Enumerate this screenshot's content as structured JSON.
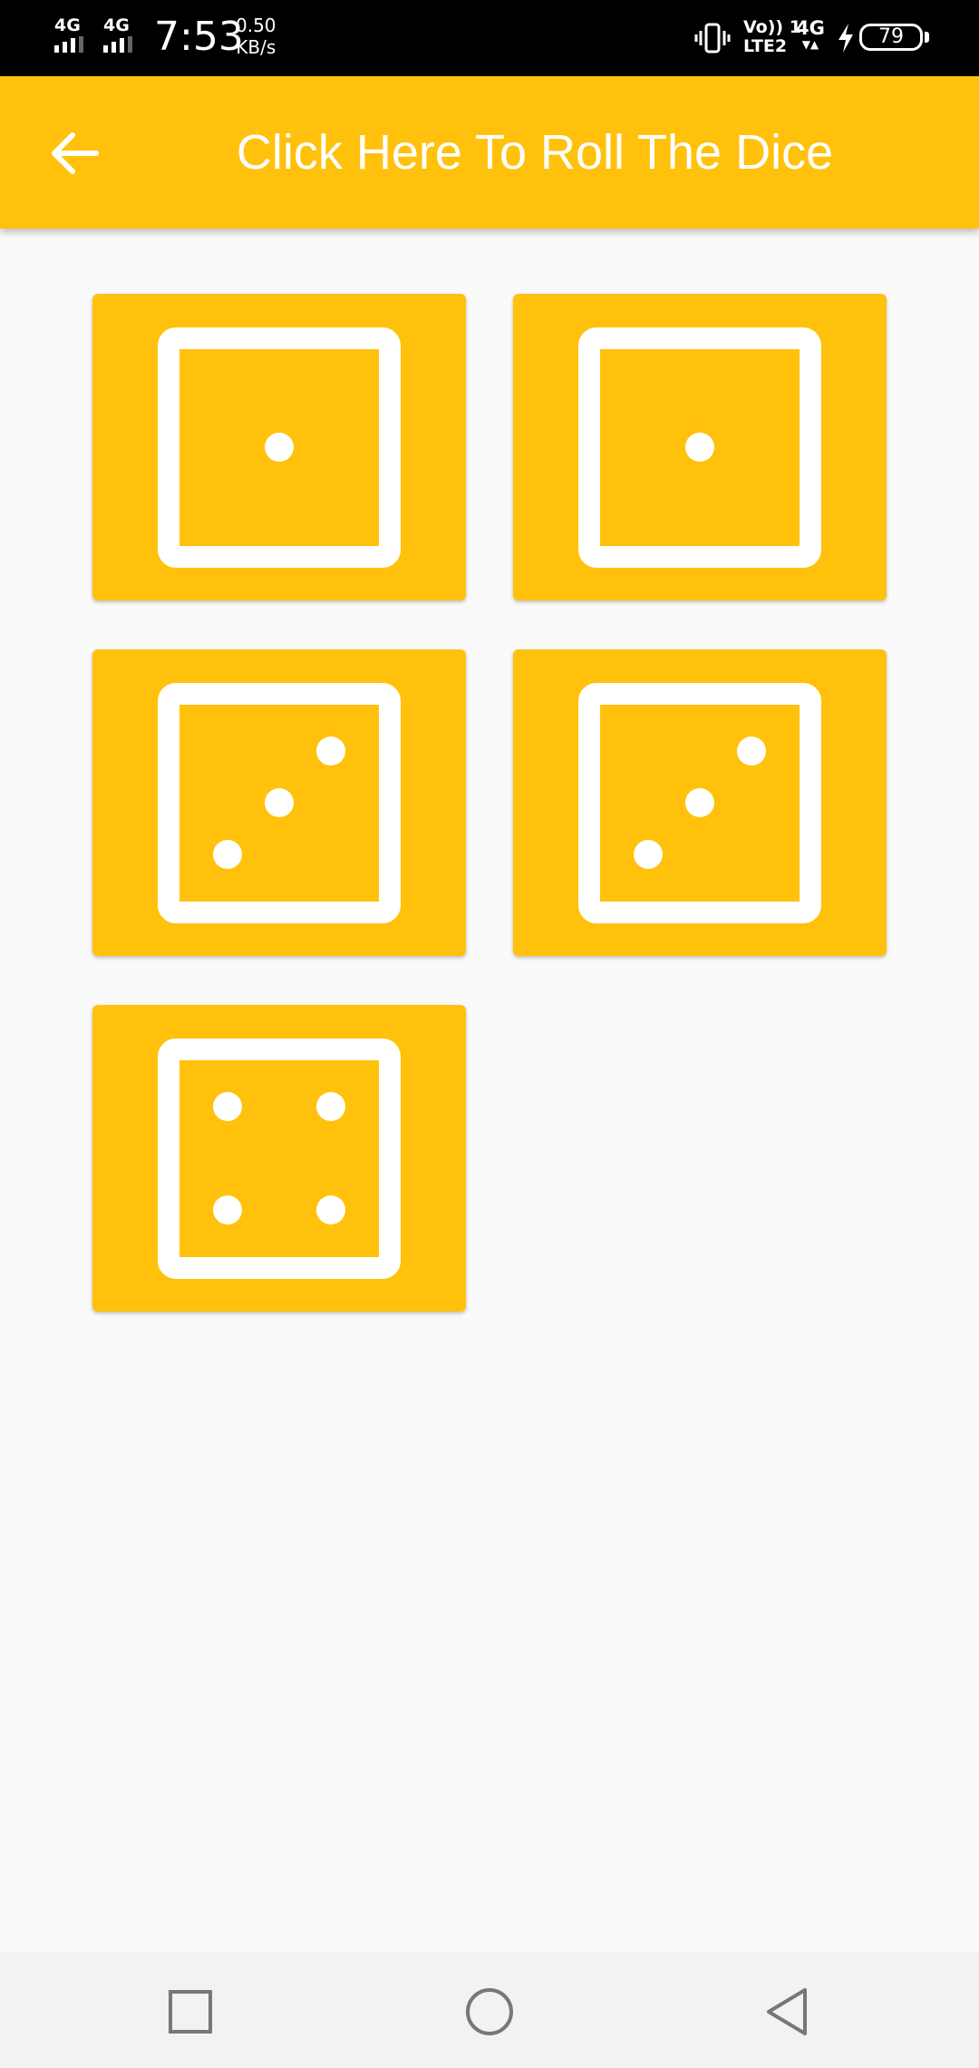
{
  "status_bar": {
    "sim1_network": "4G",
    "sim2_network": "4G",
    "time": "7:53",
    "speed_value": "0.50",
    "speed_unit": "KB/s",
    "volte_line1": "Vo)) 1",
    "volte_line2": "LTE2",
    "data_network": "4G",
    "battery_level": "79",
    "icons": [
      "signal-icon",
      "signal-icon",
      "vibrate-icon",
      "charging-icon",
      "battery-icon"
    ]
  },
  "app_bar": {
    "title": "Click Here To Roll The Dice",
    "back_icon": "arrow-back-icon",
    "background_color": "#ffc10b"
  },
  "dice": [
    {
      "value": 1
    },
    {
      "value": 1
    },
    {
      "value": 3
    },
    {
      "value": 3
    },
    {
      "value": 4
    }
  ],
  "colors": {
    "accent": "#ffc10b",
    "dice_face": "#ffffff",
    "background": "#fafafa"
  },
  "nav_bar": {
    "buttons": [
      "recents-square-icon",
      "home-circle-icon",
      "back-triangle-icon"
    ]
  }
}
